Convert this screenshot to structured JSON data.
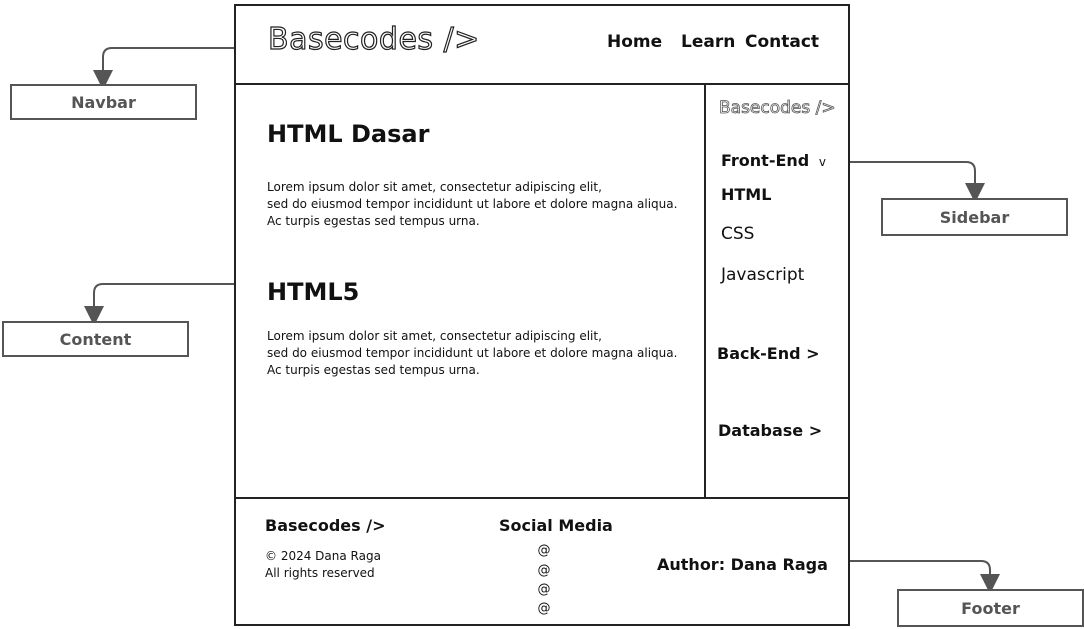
{
  "navbar": {
    "logo": "Basecodes />",
    "links": [
      "Home",
      "Learn",
      "Contact"
    ]
  },
  "content": {
    "sections": [
      {
        "heading": "HTML Dasar",
        "lines": [
          "Lorem ipsum dolor sit amet, consectetur adipiscing elit,",
          "sed do eiusmod tempor incididunt ut labore et dolore magna aliqua.",
          "Ac turpis egestas sed tempus urna."
        ]
      },
      {
        "heading": "HTML5",
        "lines": [
          "Lorem ipsum dolor sit amet, consectetur adipiscing elit,",
          "sed do eiusmod tempor incididunt ut labore et dolore magna aliqua.",
          "Ac turpis egestas sed tempus urna."
        ]
      }
    ]
  },
  "sidebar": {
    "logo": "Basecodes />",
    "front_end": "Front-End",
    "front_end_arrow": "v",
    "items": [
      "HTML",
      "CSS",
      "Javascript"
    ],
    "back_end": "Back-End >",
    "database": "Database >"
  },
  "footer": {
    "brand": "Basecodes />",
    "copyright": "© 2024 Dana Raga",
    "rights": "All rights reserved",
    "social_title": "Social Media",
    "social_icons": [
      "@",
      "@",
      "@",
      "@"
    ],
    "author": "Author: Dana Raga"
  },
  "labels": {
    "navbar": "Navbar",
    "content": "Content",
    "sidebar": "Sidebar",
    "footer": "Footer"
  }
}
